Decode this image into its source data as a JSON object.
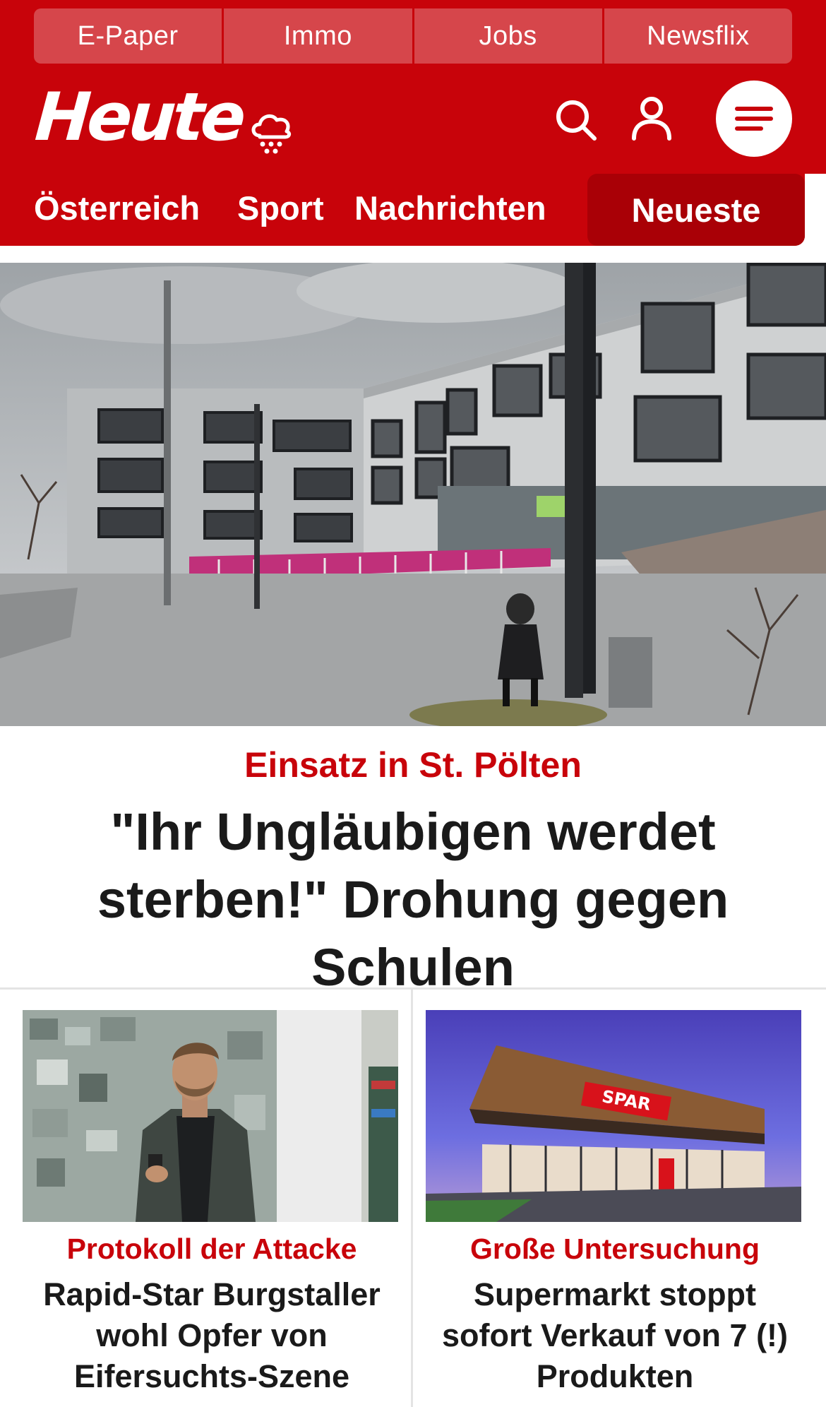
{
  "top_links": [
    "E-Paper",
    "Immo",
    "Jobs",
    "Newsflix"
  ],
  "brand": {
    "logo_text": "Heute",
    "primary_color": "#c8030a",
    "nav_active_color": "#a90006"
  },
  "header_icons": [
    "weather-rain-icon",
    "search-icon",
    "user-icon",
    "menu-icon"
  ],
  "nav": {
    "items": [
      "Österreich",
      "Sport",
      "Nachrichten"
    ],
    "active": "Neueste"
  },
  "hero": {
    "image": "school-building-photo",
    "kicker": "Einsatz in St. Pölten",
    "title_line1": "\"Ihr Ungläubigen werdet",
    "title_line2": "sterben!\" Drohung gegen Schulen"
  },
  "teasers": [
    {
      "image": "football-player-photo",
      "kicker": "Protokoll der Attacke",
      "title_lines": [
        "Rapid-Star Burgstaller",
        "wohl Opfer von",
        "Eifersuchts-Szene"
      ]
    },
    {
      "image": "supermarket-photo",
      "kicker": "Große Untersuchung",
      "title_lines": [
        "Supermarkt stoppt",
        "sofort Verkauf von 7 (!)",
        "Produkten"
      ]
    }
  ]
}
